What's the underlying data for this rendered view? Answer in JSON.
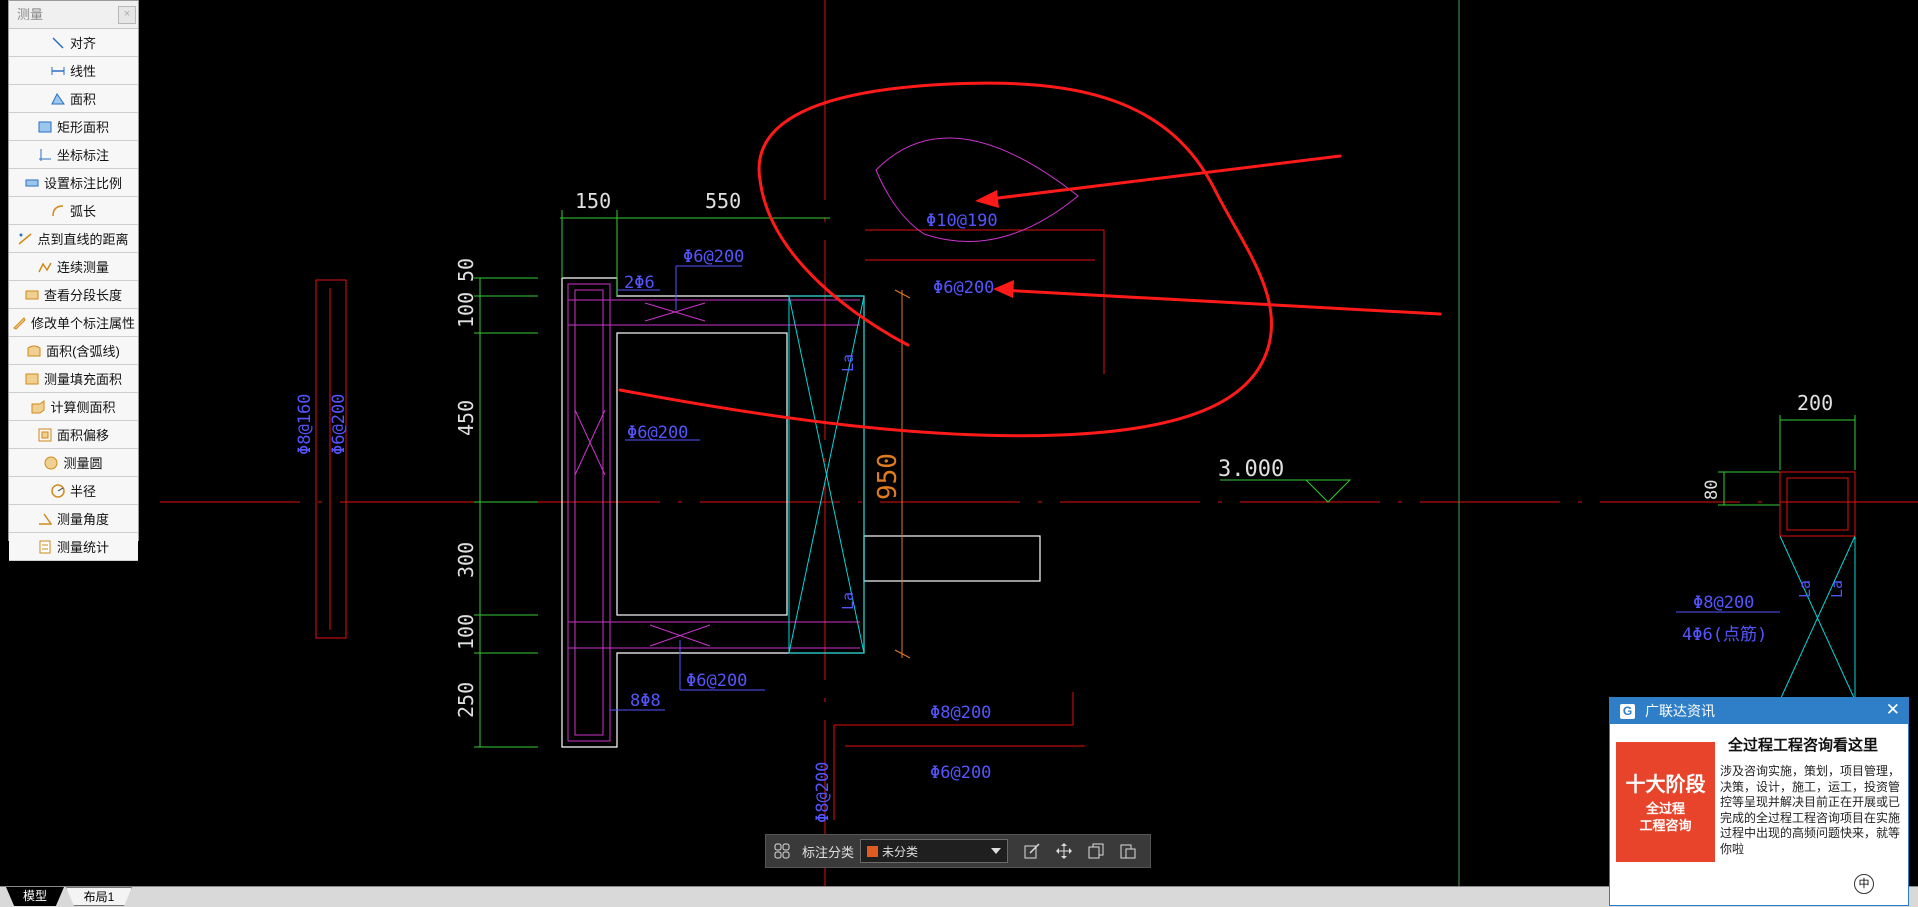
{
  "palette": {
    "title": "测量",
    "close_glyph": "×",
    "items": [
      "对齐",
      "线性",
      "面积",
      "矩形面积",
      "坐标标注",
      "设置标注比例",
      "弧长",
      "点到直线的距离",
      "连续测量",
      "查看分段长度",
      "修改单个标注属性",
      "面积(含弧线)",
      "测量填充面积",
      "计算侧面积",
      "面积偏移",
      "测量圆",
      "半径",
      "测量角度",
      "测量统计"
    ]
  },
  "drawing": {
    "dim_150": "150",
    "dim_550": "550",
    "dim_50": "50",
    "dim_100a": "100",
    "dim_450": "450",
    "dim_300": "300",
    "dim_100b": "100",
    "dim_250": "250",
    "dim_950": "950",
    "dim_200": "200",
    "dim_80": "80",
    "rebar_2phi6": "2Φ6",
    "rebar_phi6_200_top": "Φ6@200",
    "rebar_phi6_200_mid": "Φ6@200",
    "rebar_phi6_200_bot": "Φ6@200",
    "rebar_phi10_190": "Φ10@190",
    "rebar_phi6_200_right": "Φ6@200",
    "rebar_8phi8": "8Φ8",
    "rebar_phi8_160": "Φ8@160",
    "rebar_phi6_200_left": "Φ6@200",
    "rebar_phi8_200_low": "Φ8@200",
    "rebar_phi6_200_low": "Φ6@200",
    "rebar_phi8_200_vert": "Φ8@200",
    "rebar_phi8_200_right": "Φ8@200",
    "rebar_4phi6": "4Φ6(点筋)",
    "la_1": "La",
    "la_2": "La",
    "la_3": "La",
    "la_4": "La",
    "elev": "3.000"
  },
  "annotation_bar": {
    "label": "标注分类",
    "selected": "未分类",
    "swatch_color": "#e15a1f"
  },
  "tabs": {
    "model": "模型",
    "layout1": "布局1"
  },
  "news": {
    "header": "广联达资讯",
    "logo_letter": "G",
    "close_glyph": "✕",
    "image_big": "十大阶段",
    "image_small_1": "全过程",
    "image_small_2": "工程咨询",
    "title": "全过程工程咨询看这里",
    "body": "涉及咨询实施，策划，项目管理，决策，设计，施工，运工，投资管控等呈现并解决目前正在开展或已完成的全过程工程咨询项目在实施过程中出现的高频问题快来，就等你啦",
    "ime": "中"
  },
  "colors": {
    "background": "#000000",
    "axis_red": "#ff0000",
    "dim_green": "#33cc33",
    "rebar_blue": "#5555ff",
    "outline_white": "#ffffff",
    "cyan": "#00e5e5",
    "magenta": "#cc33cc",
    "annotation_red": "#ff1a1a",
    "orange": "#e07b1f"
  }
}
